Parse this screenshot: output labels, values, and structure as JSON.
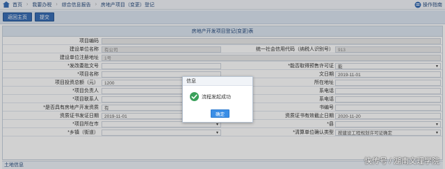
{
  "breadcrumb": {
    "items": [
      "首页",
      "我要办税",
      "综合信息报告",
      "房地产项目（变更）登记"
    ],
    "separator": "›",
    "guide_label": "操作指南"
  },
  "toolbar": {
    "back_label": "返回主页",
    "submit_label": "提交"
  },
  "form": {
    "title": "房地产开发项目登记(变更)表",
    "fields": {
      "project_code_label": "项目编码",
      "unit_name_label": "建设单位名称",
      "unit_name_value": "                   有公司",
      "credit_code_label": "统一社会信用代码（纳税人识别号）",
      "credit_code_value": "913",
      "address_label": "建设单位注册地址",
      "address_value": "                            1号",
      "approval_label": "*发改委批文号",
      "permit_label": "*能否取得预售许可证",
      "permit_value": "能",
      "project_name_label": "*项目名称",
      "date_label": "文日期",
      "date_value": "2019-11-01",
      "investment_label": "项目投资总额（元）",
      "investment_value": "1200",
      "location_label": "所在地址",
      "manager_label": "*项目负责人",
      "manager_phone_label": "系电话",
      "contact_label": "*项目联系人",
      "contact_phone_label": "系电话",
      "hasdev_label": "*是否具有房地产开发资质",
      "hasdev_value": "有",
      "cert_no_label": "书编号",
      "cert_issue_label": "资质证书发证日期",
      "cert_issue_value": "2019-11-01",
      "cert_expire_label": "资质证书有效截止日期",
      "cert_expire_value": "2020-11-20",
      "city_label": "*项目所在市",
      "county_label": "*县",
      "town_label": "*乡镇（街道）",
      "land_label": "*清算单位确认类型",
      "land_value": "按建设工程规划许可证确定"
    }
  },
  "footer": {
    "label": "土地信息"
  },
  "dialog": {
    "title": "信息",
    "message": "流程发起成功",
    "ok_label": "确定"
  },
  "watermark": "快传号 / 湖南文理学院"
}
